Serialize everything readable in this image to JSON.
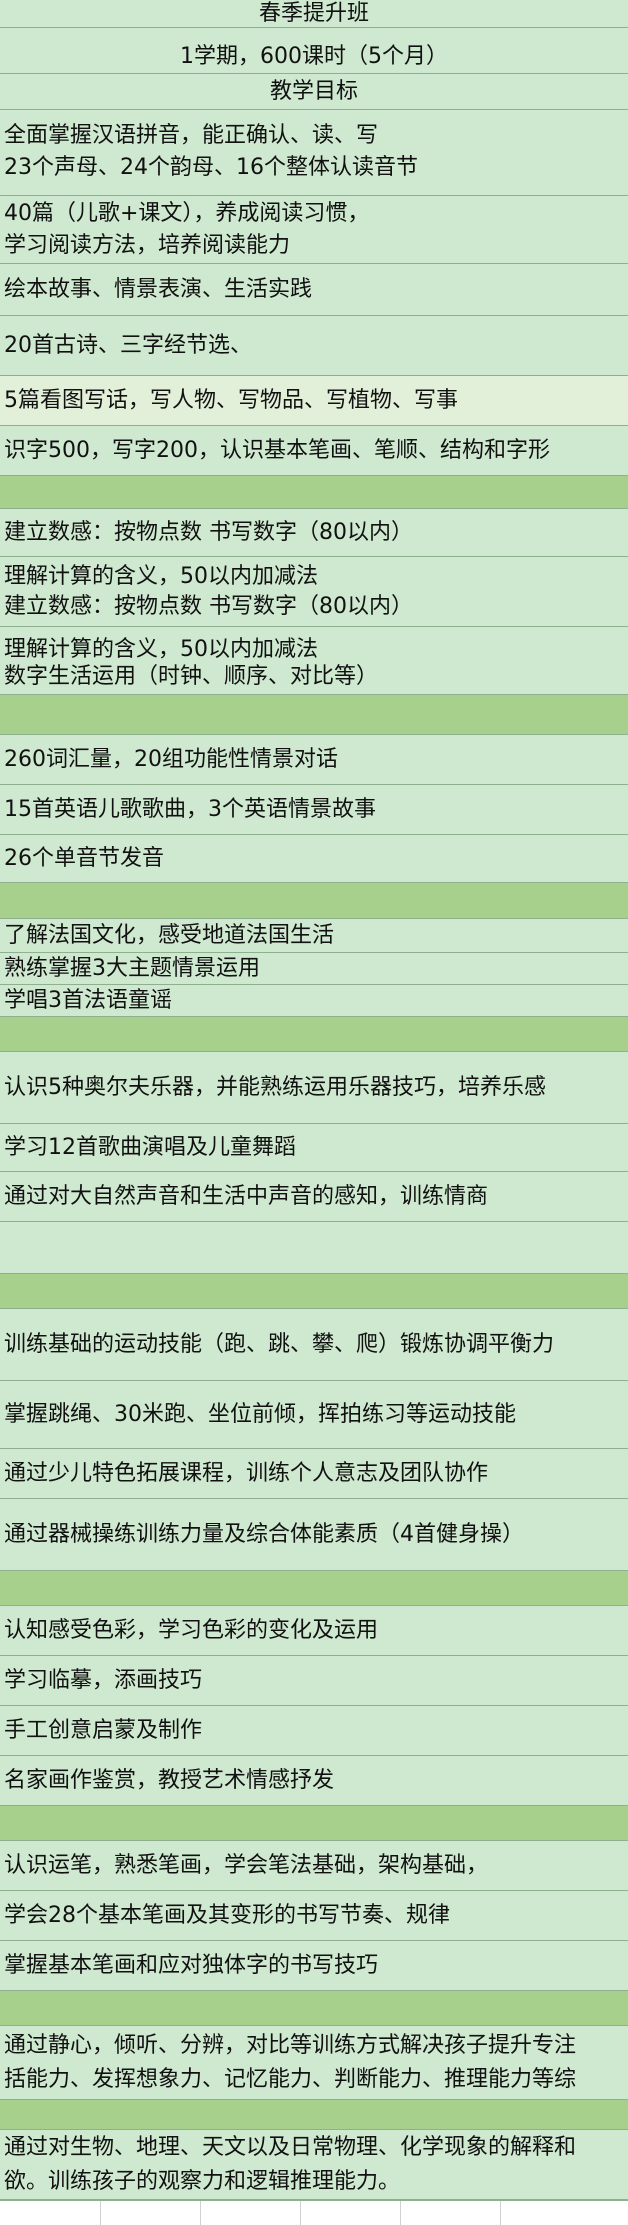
{
  "sheet": {
    "title": "春季提升班",
    "subtitle": "1学期，600课时（5个月）",
    "goal_header": "教学目标",
    "rows": [
      {
        "lines": [
          "全面掌握汉语拼音，能正确认、读、写",
          "23个声母、24个韵母、16个整体认读音节"
        ]
      },
      {
        "lines": [
          "40篇（儿歌+课文），养成阅读习惯，",
          "学习阅读方法，培养阅读能力"
        ]
      },
      {
        "lines": [
          "绘本故事、情景表演、生活实践"
        ]
      },
      {
        "lines": [
          "20首古诗、三字经节选、"
        ]
      },
      {
        "lines": [
          "5篇看图写话，写人物、写物品、写植物、写事"
        ]
      },
      {
        "lines": [
          "识字500，写字200，认识基本笔画、笔顺、结构和字形"
        ]
      },
      {
        "lines": [
          ""
        ]
      },
      {
        "lines": [
          "建立数感：按物点数 书写数字（80以内）"
        ]
      },
      {
        "lines": [
          "理解计算的含义，50以内加减法",
          "建立数感：按物点数 书写数字（80以内）"
        ]
      },
      {
        "lines": [
          "理解计算的含义，50以内加减法",
          "数字生活运用（时钟、顺序、对比等）"
        ]
      },
      {
        "lines": [
          ""
        ]
      },
      {
        "lines": [
          "260词汇量，20组功能性情景对话"
        ]
      },
      {
        "lines": [
          "15首英语儿歌歌曲，3个英语情景故事"
        ]
      },
      {
        "lines": [
          "26个单音节发音"
        ]
      },
      {
        "lines": [
          ""
        ]
      },
      {
        "lines": [
          "了解法国文化，感受地道法国生活"
        ]
      },
      {
        "lines": [
          "熟练掌握3大主题情景运用"
        ]
      },
      {
        "lines": [
          "学唱3首法语童谣"
        ]
      },
      {
        "lines": [
          ""
        ]
      },
      {
        "lines": [
          "认识5种奥尔夫乐器，并能熟练运用乐器技巧，培养乐感"
        ]
      },
      {
        "lines": [
          "学习12首歌曲演唱及儿童舞蹈"
        ]
      },
      {
        "lines": [
          "通过对大自然声音和生活中声音的感知，训练情商"
        ]
      },
      {
        "lines": [
          ""
        ]
      },
      {
        "lines": [
          ""
        ]
      },
      {
        "lines": [
          "训练基础的运动技能（跑、跳、攀、爬）锻炼协调平衡力"
        ]
      },
      {
        "lines": [
          "掌握跳绳、30米跑、坐位前倾，挥拍练习等运动技能"
        ]
      },
      {
        "lines": [
          "通过少儿特色拓展课程，训练个人意志及团队协作"
        ]
      },
      {
        "lines": [
          "通过器械操练训练力量及综合体能素质（4首健身操）"
        ]
      },
      {
        "lines": [
          ""
        ]
      },
      {
        "lines": [
          "认知感受色彩，学习色彩的变化及运用"
        ]
      },
      {
        "lines": [
          "学习临摹，添画技巧"
        ]
      },
      {
        "lines": [
          "手工创意启蒙及制作"
        ]
      },
      {
        "lines": [
          "名家画作鉴赏，教授艺术情感抒发"
        ]
      },
      {
        "lines": [
          ""
        ]
      },
      {
        "lines": [
          "认识运笔，熟悉笔画，学会笔法基础，架构基础，"
        ]
      },
      {
        "lines": [
          "学会28个基本笔画及其变形的书写节奏、规律"
        ]
      },
      {
        "lines": [
          "掌握基本笔画和应对独体字的书写技巧"
        ]
      },
      {
        "lines": [
          ""
        ]
      },
      {
        "lines": [
          "通过静心，倾听、分辨，对比等训练方式解决孩子提升专注",
          "括能力、发挥想象力、记忆能力、判断能力、推理能力等综"
        ]
      },
      {
        "lines": [
          ""
        ]
      },
      {
        "lines": [
          "通过对生物、地理、天文以及日常物理、化学现象的解释和",
          "欲。训练孩子的观察力和逻辑推理能力。"
        ]
      }
    ]
  }
}
